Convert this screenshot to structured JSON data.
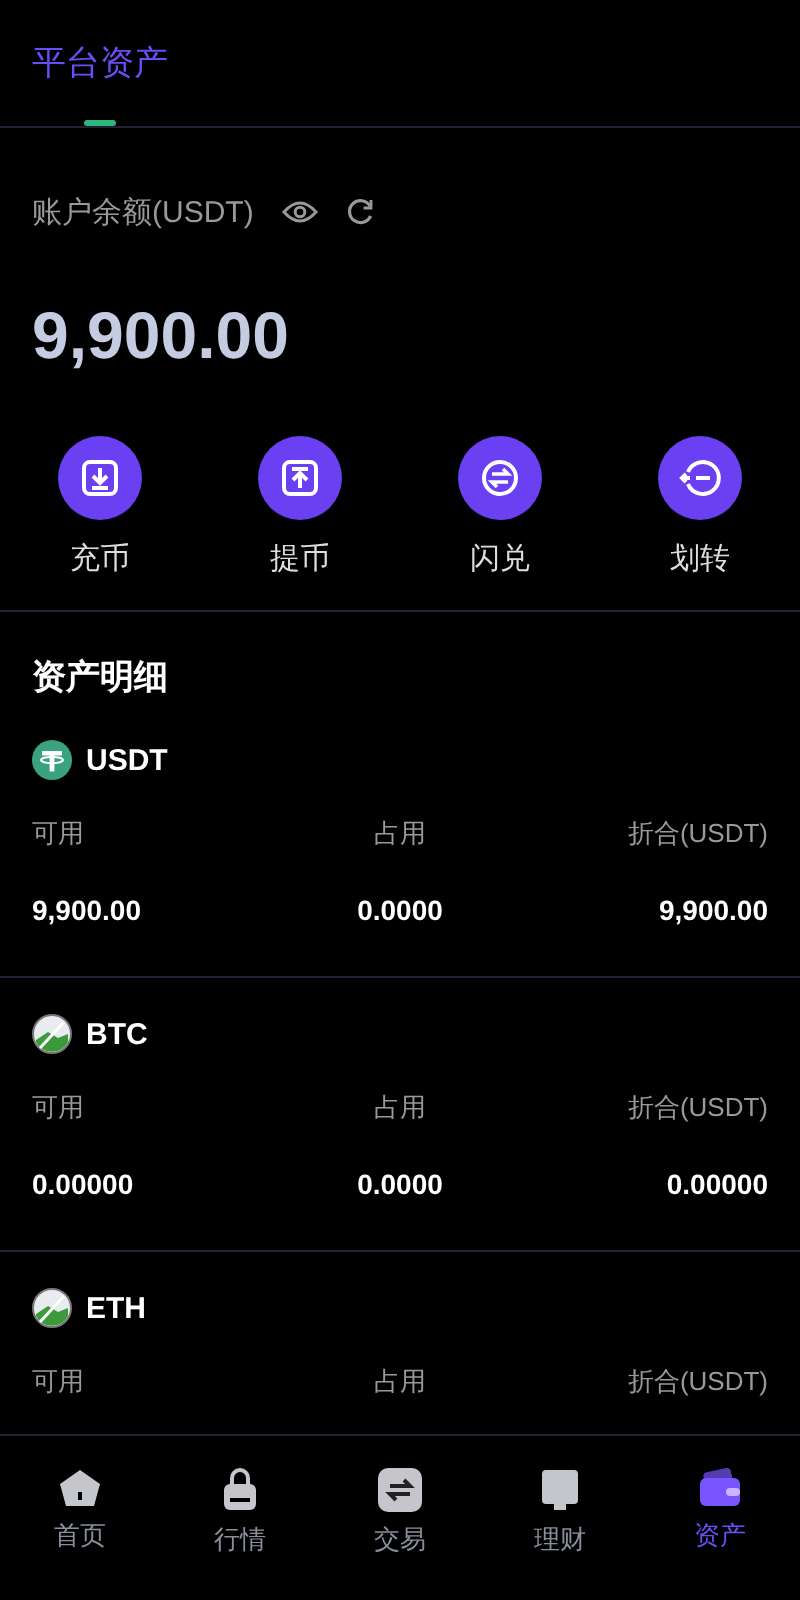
{
  "header": {
    "tabs": [
      {
        "label": "平台资产",
        "selected": true
      }
    ]
  },
  "balance": {
    "label": "账户余额(USDT)",
    "amount": "9,900.00"
  },
  "actions": [
    {
      "label": "充币",
      "kind": "deposit"
    },
    {
      "label": "提币",
      "kind": "withdraw"
    },
    {
      "label": "闪兑",
      "kind": "swap"
    },
    {
      "label": "划转",
      "kind": "transfer"
    }
  ],
  "section_title": "资产明细",
  "assets": [
    {
      "name": "USDT",
      "kind": "tether",
      "columns": [
        {
          "label": "可用",
          "value": "9,900.00"
        },
        {
          "label": "占用",
          "value": "0.0000"
        },
        {
          "label": "折合(USDT)",
          "value": "9,900.00"
        }
      ]
    },
    {
      "name": "BTC",
      "kind": "broken",
      "columns": [
        {
          "label": "可用",
          "value": "0.00000"
        },
        {
          "label": "占用",
          "value": "0.0000"
        },
        {
          "label": "折合(USDT)",
          "value": "0.00000"
        }
      ]
    },
    {
      "name": "ETH",
      "kind": "broken",
      "columns": [
        {
          "label": "可用"
        },
        {
          "label": "占用"
        },
        {
          "label": "折合(USDT)"
        }
      ]
    }
  ],
  "bottom_nav": [
    {
      "label": "首页",
      "kind": "home",
      "selected": false
    },
    {
      "label": "行情",
      "kind": "market",
      "selected": false
    },
    {
      "label": "交易",
      "kind": "trade",
      "selected": false
    },
    {
      "label": "理财",
      "kind": "finance",
      "selected": false
    },
    {
      "label": "资产",
      "kind": "assets",
      "selected": true
    }
  ]
}
